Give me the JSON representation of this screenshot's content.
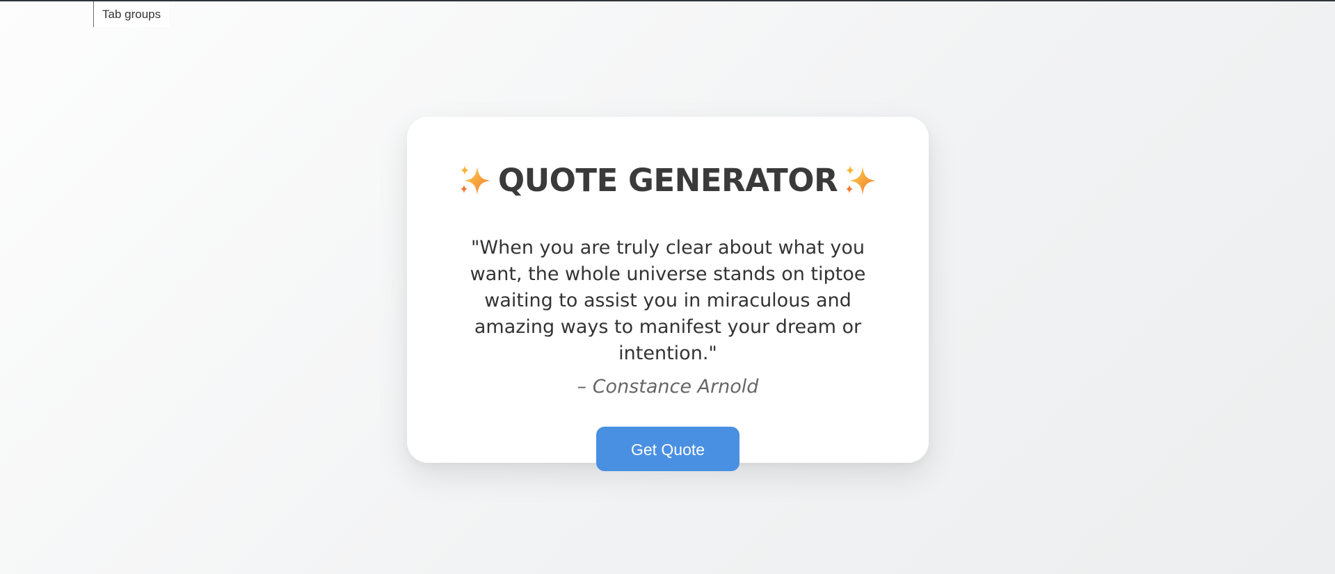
{
  "browser": {
    "tab_groups_label": "Tab groups"
  },
  "card": {
    "title": "QUOTE GENERATOR",
    "title_icon_left": "sparkles-icon",
    "title_icon_right": "sparkles-icon",
    "quote": "\"When you are truly clear about what you want, the whole universe stands on tiptoe waiting to assist you in miraculous and amazing ways to manifest your dream or intention.\"",
    "author": "– Constance Arnold",
    "button_label": "Get Quote"
  },
  "colors": {
    "accent": "#4a90e2",
    "title": "#3a3a3a",
    "quote_text": "#333333",
    "author_text": "#666666",
    "sparkle_gold": "#f9b233",
    "sparkle_orange": "#f2762e"
  }
}
